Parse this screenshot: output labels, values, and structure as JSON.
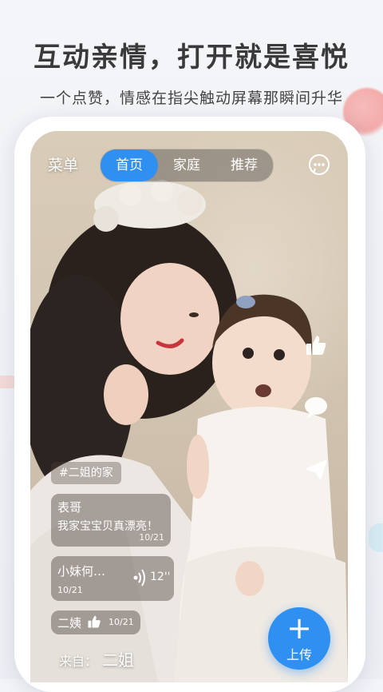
{
  "promo": {
    "headline": "互动亲情，打开就是喜悦",
    "subline": "一个点赞，情感在指尖触动屏幕那瞬间升华"
  },
  "topbar": {
    "menu_label": "菜单",
    "tabs": [
      {
        "label": "首页",
        "active": true
      },
      {
        "label": "家庭",
        "active": false
      },
      {
        "label": "推荐",
        "active": false
      }
    ]
  },
  "post": {
    "tag": "#二姐的家",
    "comments": [
      {
        "name": "表哥",
        "text": "我家宝宝贝真漂亮！",
        "date": "10/21"
      },
      {
        "name": "小妹何…",
        "date": "10/21",
        "voice_duration": "12''"
      },
      {
        "name": "二姨",
        "date": "10/21"
      }
    ],
    "from_label": "来自：",
    "from_name": "二姐"
  },
  "upload": {
    "label": "上传"
  },
  "icons": {
    "chat": "chat-bubble-icon",
    "like": "thumbs-up-icon",
    "comment": "comment-icon",
    "share": "share-icon",
    "voice": "voice-wave-icon",
    "plus": "plus-icon"
  },
  "colors": {
    "accent": "#2f90f2"
  }
}
